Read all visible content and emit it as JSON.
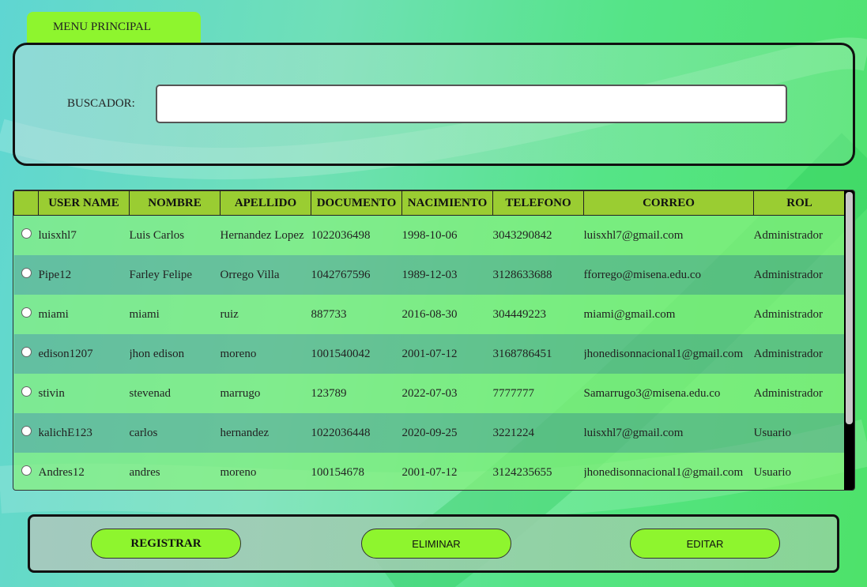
{
  "menu_tab": {
    "label": "MENU PRINCIPAL"
  },
  "search": {
    "label": "BUSCADOR:",
    "value": "",
    "placeholder": ""
  },
  "table": {
    "columns": [
      "",
      "USER NAME",
      "NOMBRE",
      "APELLIDO",
      "DOCUMENTO",
      "NACIMIENTO",
      "TELEFONO",
      "CORREO",
      "ROL"
    ],
    "rows": [
      {
        "user": "luisxhl7",
        "nombre": "Luis Carlos",
        "apellido": "Hernandez Lopez",
        "documento": "1022036498",
        "nacimiento": "1998-10-06",
        "telefono": "3043290842",
        "correo": "luisxhl7@gmail.com",
        "rol": "Administrador"
      },
      {
        "user": "Pipe12",
        "nombre": "Farley Felipe",
        "apellido": "Orrego Villa",
        "documento": "1042767596",
        "nacimiento": "1989-12-03",
        "telefono": "3128633688",
        "correo": "fforrego@misena.edu.co",
        "rol": "Administrador"
      },
      {
        "user": "miami",
        "nombre": "miami",
        "apellido": "ruiz",
        "documento": "887733",
        "nacimiento": "2016-08-30",
        "telefono": "304449223",
        "correo": "miami@gmail.com",
        "rol": "Administrador"
      },
      {
        "user": "edison1207",
        "nombre": "jhon edison",
        "apellido": "moreno",
        "documento": "1001540042",
        "nacimiento": "2001-07-12",
        "telefono": "3168786451",
        "correo": "jhonedisonnacional1@gmail.com",
        "rol": "Administrador"
      },
      {
        "user": "stivin",
        "nombre": "stevenad",
        "apellido": "marrugo",
        "documento": "123789",
        "nacimiento": "2022-07-03",
        "telefono": "7777777",
        "correo": "Samarrugo3@misena.edu.co",
        "rol": "Administrador"
      },
      {
        "user": "kalichE123",
        "nombre": "carlos",
        "apellido": "hernandez",
        "documento": "1022036448",
        "nacimiento": "2020-09-25",
        "telefono": "3221224",
        "correo": "luisxhl7@gmail.com",
        "rol": "Usuario"
      },
      {
        "user": "Andres12",
        "nombre": "andres",
        "apellido": "moreno",
        "documento": "100154678",
        "nacimiento": "2001-07-12",
        "telefono": "3124235655",
        "correo": "jhonedisonnacional1@gmail.com",
        "rol": "Usuario"
      }
    ]
  },
  "actions": {
    "registrar": "REGISTRAR",
    "eliminar": "ELIMINAR",
    "editar": "EDITAR"
  },
  "colors": {
    "accent": "#8ef52e",
    "header": "#9acd32"
  }
}
